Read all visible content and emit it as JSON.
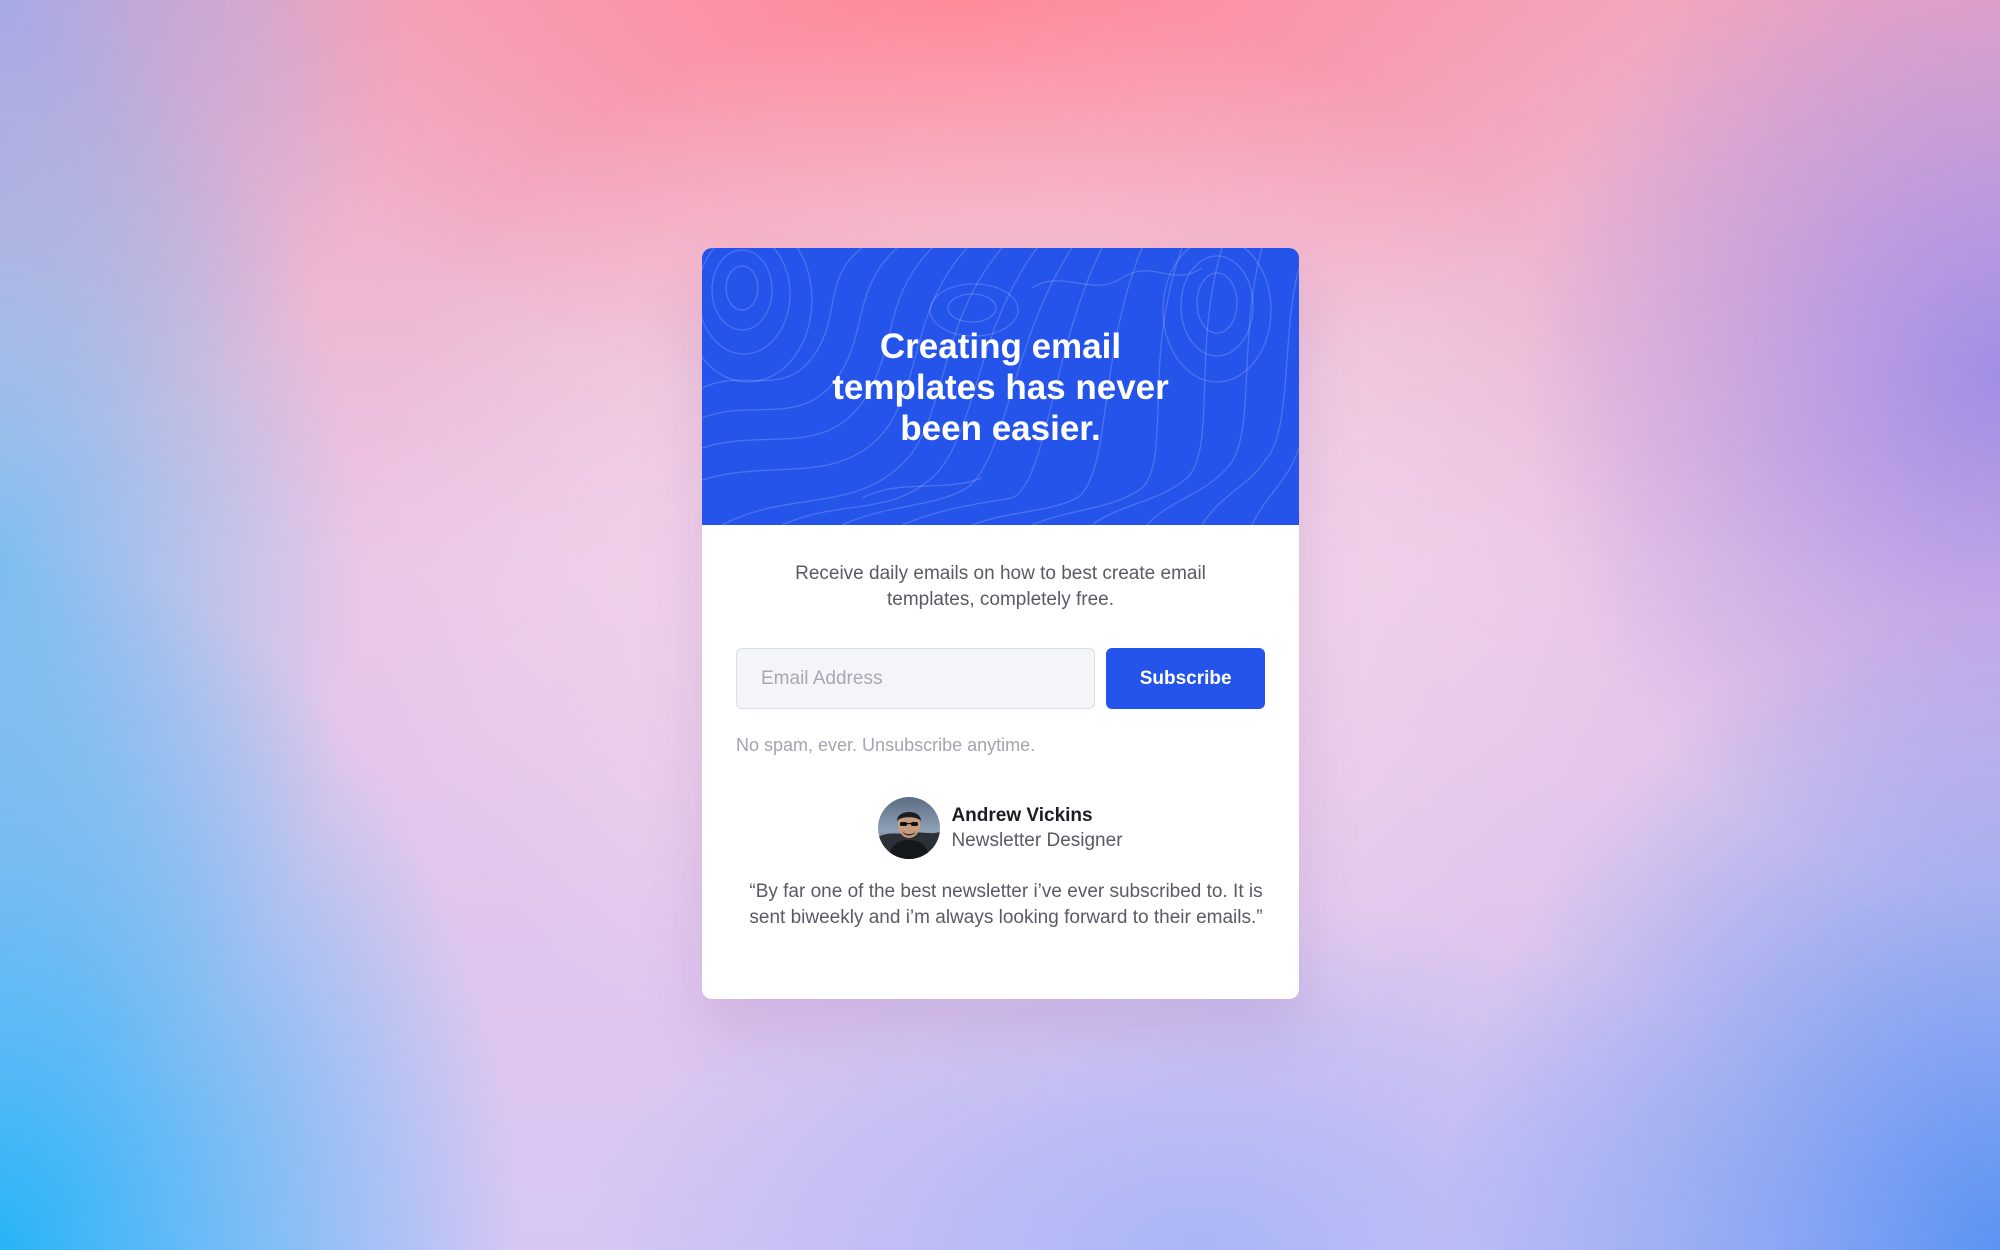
{
  "hero": {
    "title": "Creating email templates has never been easier."
  },
  "intro": {
    "text": "Receive daily emails on how to best create email templates, completely free."
  },
  "form": {
    "email_placeholder": "Email Address",
    "email_value": "",
    "subscribe_label": "Subscribe"
  },
  "notice": {
    "text": "No spam, ever. Unsubscribe anytime."
  },
  "testimonial": {
    "author_name": "Andrew Vickins",
    "author_role": "Newsletter Designer",
    "quote": "“By far one of the best newsletter i’ve ever subscribed to. It is sent biweekly and i’m always looking forward to their emails.”"
  },
  "colors": {
    "accent": "#2554ea",
    "card_background": "#ffffff",
    "input_background": "#f4f5f9"
  }
}
